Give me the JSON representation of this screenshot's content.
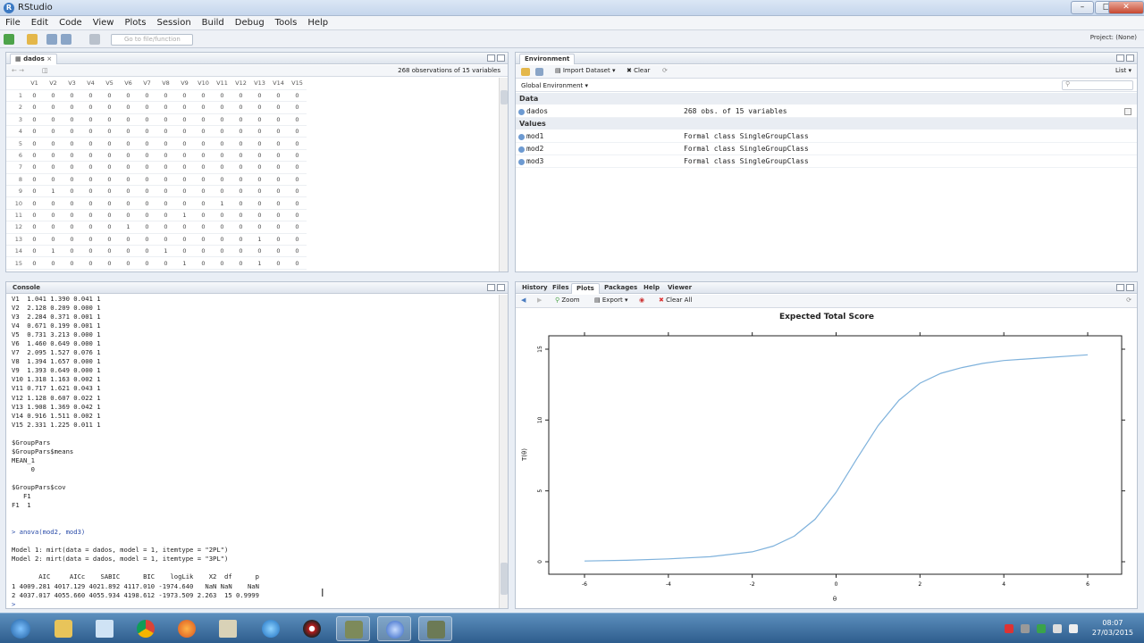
{
  "window": {
    "title": "RStudio",
    "app_logo": "R"
  },
  "menu": [
    "File",
    "Edit",
    "Code",
    "View",
    "Plots",
    "Session",
    "Build",
    "Debug",
    "Tools",
    "Help"
  ],
  "toolbar": {
    "goto_placeholder": "Go to file/function",
    "project": "Project: (None)"
  },
  "data_viewer": {
    "tab": "dados",
    "summary": "268 observations of 15 variables",
    "columns": [
      "V1",
      "V2",
      "V3",
      "V4",
      "V5",
      "V6",
      "V7",
      "V8",
      "V9",
      "V10",
      "V11",
      "V12",
      "V13",
      "V14",
      "V15"
    ],
    "rows": [
      [
        "1",
        "0",
        "0",
        "0",
        "0",
        "0",
        "0",
        "0",
        "0",
        "0",
        "0",
        "0",
        "0",
        "0",
        "0",
        "0"
      ],
      [
        "2",
        "0",
        "0",
        "0",
        "0",
        "0",
        "0",
        "0",
        "0",
        "0",
        "0",
        "0",
        "0",
        "0",
        "0",
        "0"
      ],
      [
        "3",
        "0",
        "0",
        "0",
        "0",
        "0",
        "0",
        "0",
        "0",
        "0",
        "0",
        "0",
        "0",
        "0",
        "0",
        "0"
      ],
      [
        "4",
        "0",
        "0",
        "0",
        "0",
        "0",
        "0",
        "0",
        "0",
        "0",
        "0",
        "0",
        "0",
        "0",
        "0",
        "0"
      ],
      [
        "5",
        "0",
        "0",
        "0",
        "0",
        "0",
        "0",
        "0",
        "0",
        "0",
        "0",
        "0",
        "0",
        "0",
        "0",
        "0"
      ],
      [
        "6",
        "0",
        "0",
        "0",
        "0",
        "0",
        "0",
        "0",
        "0",
        "0",
        "0",
        "0",
        "0",
        "0",
        "0",
        "0"
      ],
      [
        "7",
        "0",
        "0",
        "0",
        "0",
        "0",
        "0",
        "0",
        "0",
        "0",
        "0",
        "0",
        "0",
        "0",
        "0",
        "0"
      ],
      [
        "8",
        "0",
        "0",
        "0",
        "0",
        "0",
        "0",
        "0",
        "0",
        "0",
        "0",
        "0",
        "0",
        "0",
        "0",
        "0"
      ],
      [
        "9",
        "0",
        "1",
        "0",
        "0",
        "0",
        "0",
        "0",
        "0",
        "0",
        "0",
        "0",
        "0",
        "0",
        "0",
        "0"
      ],
      [
        "10",
        "0",
        "0",
        "0",
        "0",
        "0",
        "0",
        "0",
        "0",
        "0",
        "0",
        "1",
        "0",
        "0",
        "0",
        "0"
      ],
      [
        "11",
        "0",
        "0",
        "0",
        "0",
        "0",
        "0",
        "0",
        "0",
        "1",
        "0",
        "0",
        "0",
        "0",
        "0",
        "0"
      ],
      [
        "12",
        "0",
        "0",
        "0",
        "0",
        "0",
        "1",
        "0",
        "0",
        "0",
        "0",
        "0",
        "0",
        "0",
        "0",
        "0"
      ],
      [
        "13",
        "0",
        "0",
        "0",
        "0",
        "0",
        "0",
        "0",
        "0",
        "0",
        "0",
        "0",
        "0",
        "1",
        "0",
        "0"
      ],
      [
        "14",
        "0",
        "1",
        "0",
        "0",
        "0",
        "0",
        "0",
        "1",
        "0",
        "0",
        "0",
        "0",
        "0",
        "0",
        "0"
      ],
      [
        "15",
        "0",
        "0",
        "0",
        "0",
        "0",
        "0",
        "0",
        "0",
        "1",
        "0",
        "0",
        "0",
        "1",
        "0",
        "0"
      ]
    ]
  },
  "environment": {
    "tab": "Environment",
    "import_label": "Import Dataset",
    "clear_label": "Clear",
    "list_label": "List",
    "scope": "Global Environment",
    "sections": [
      {
        "title": "Data",
        "items": [
          {
            "name": "dados",
            "value": "268 obs. of 15 variables"
          }
        ]
      },
      {
        "title": "Values",
        "items": [
          {
            "name": "mod1",
            "value": "Formal class SingleGroupClass"
          },
          {
            "name": "mod2",
            "value": "Formal class SingleGroupClass"
          },
          {
            "name": "mod3",
            "value": "Formal class SingleGroupClass"
          }
        ]
      }
    ]
  },
  "console": {
    "tab": "Console",
    "lines": [
      "V1  1.041 1.390 0.041 1",
      "V2  2.128 0.209 0.000 1",
      "V3  2.284 0.371 0.001 1",
      "V4  0.671 0.199 0.001 1",
      "V5  0.731 3.213 0.000 1",
      "V6  1.460 0.649 0.000 1",
      "V7  2.095 1.527 0.076 1",
      "V8  1.394 1.657 0.000 1",
      "V9  1.393 0.649 0.000 1",
      "V10 1.318 1.163 0.002 1",
      "V11 0.717 1.621 0.043 1",
      "V12 1.128 0.607 0.022 1",
      "V13 1.908 1.369 0.042 1",
      "V14 0.916 1.511 0.002 1",
      "V15 2.331 1.225 0.011 1",
      "",
      "$GroupPars",
      "$GroupPars$means",
      "MEAN_1",
      "     0",
      "",
      "$GroupPars$cov",
      "   F1",
      "F1  1",
      "",
      "",
      "> anova(mod2, mod3)",
      "",
      "Model 1: mirt(data = dados, model = 1, itemtype = \"2PL\")",
      "Model 2: mirt(data = dados, model = 1, itemtype = \"3PL\")",
      "",
      "       AIC     AICc    SABIC      BIC    logLik    X2  df      p",
      "1 4009.281 4017.129 4021.892 4117.010 -1974.640   NaN NaN    NaN",
      "2 4037.017 4055.660 4055.934 4198.612 -1973.509 2.263  15 0.9999",
      ">"
    ]
  },
  "plots_pane": {
    "tabs": [
      "History",
      "Files",
      "Plots",
      "Packages",
      "Help",
      "Viewer"
    ],
    "active_tab": "Plots",
    "zoom_label": "Zoom",
    "export_label": "Export",
    "clear_all_label": "Clear All"
  },
  "chart_data": {
    "type": "line",
    "title": "Expected Total Score",
    "xlabel": "θ",
    "ylabel": "T(θ)",
    "xlim": [
      -6,
      6
    ],
    "ylim": [
      0,
      15
    ],
    "x_ticks": [
      "-6",
      "-4",
      "-2",
      "0",
      "2",
      "4",
      "6"
    ],
    "y_ticks": [
      "0",
      "5",
      "10",
      "15"
    ],
    "color": "#7fb2dc",
    "x": [
      -6,
      -5,
      -4,
      -3,
      -2,
      -1.5,
      -1,
      -0.5,
      0,
      0.5,
      1,
      1.5,
      2,
      2.5,
      3,
      3.5,
      4,
      5,
      6
    ],
    "y": [
      0.05,
      0.1,
      0.2,
      0.35,
      0.7,
      1.1,
      1.8,
      3.0,
      4.9,
      7.3,
      9.6,
      11.4,
      12.6,
      13.3,
      13.7,
      14.0,
      14.2,
      14.4,
      14.6
    ]
  },
  "taskbar": {
    "clock_time": "08:07",
    "clock_date": "27/03/2015",
    "apps": [
      "start-orb",
      "explorer",
      "notepad",
      "chrome",
      "firefox",
      "paint",
      "ie",
      "screen-recorder",
      "rstudio-cube",
      "r-app",
      "r-gui"
    ],
    "active_app": "r-app"
  }
}
